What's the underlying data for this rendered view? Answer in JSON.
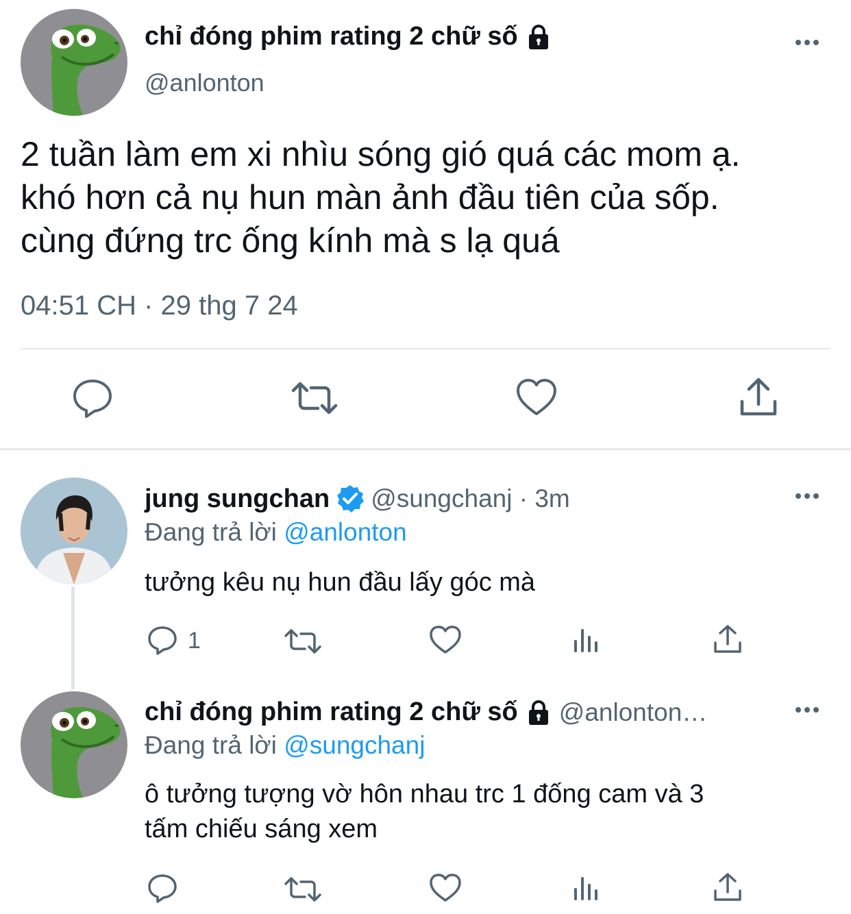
{
  "colors": {
    "text": "#0f1419",
    "muted": "#536471",
    "link": "#1d9bf0",
    "verified": "#1d9bf0",
    "divider": "#e6e8ea"
  },
  "main_tweet": {
    "display_name": "chỉ đóng phim rating 2 chữ số",
    "handle": "@anlonton",
    "protected_icon": "lock-icon",
    "avatar_icon": "dinosaur-avatar",
    "text_lines": [
      "2 tuần làm em xi nhìu sóng gió quá các mom ạ.",
      "khó hơn cả nụ hun màn ảnh đầu tiên của sốp.",
      "cùng đứng trc ống kính mà s lạ quá"
    ],
    "timestamp": "04:51 CH · 29 thg 7 24",
    "actions": [
      "reply-icon",
      "retweet-icon",
      "like-icon",
      "share-icon"
    ]
  },
  "replies": [
    {
      "display_name": "jung sungchan",
      "verified": true,
      "handle_time": "@sungchanj · 3m",
      "replying_label": "Đang trả lời",
      "replying_to": "@anlonton",
      "text_lines": [
        "tưởng kêu nụ hun đầu lấy góc mà"
      ],
      "reply_count": "1"
    },
    {
      "display_name": "chỉ đóng phim rating 2 chữ số",
      "handle": "@anlonton…",
      "replying_label": "Đang trả lời",
      "replying_to": "@sungchanj",
      "text_lines": [
        "ô tưởng tượng vờ hôn nhau trc 1 đống cam và 3",
        "tấm chiếu sáng xem"
      ]
    }
  ]
}
